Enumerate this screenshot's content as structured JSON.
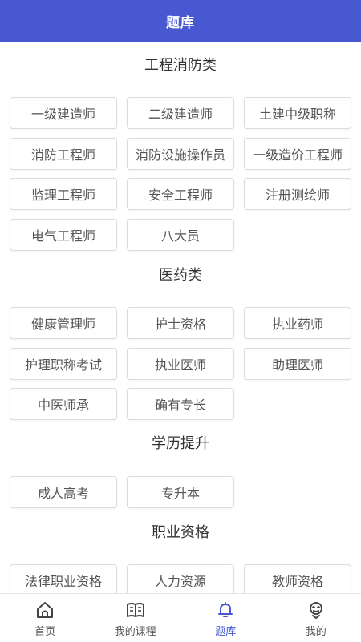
{
  "header": {
    "title": "题库"
  },
  "sections": [
    {
      "title": "工程消防类",
      "items": [
        "一级建造师",
        "二级建造师",
        "土建中级职称",
        "消防工程师",
        "消防设施操作员",
        "一级造价工程师",
        "监理工程师",
        "安全工程师",
        "注册测绘师",
        "电气工程师",
        "八大员"
      ]
    },
    {
      "title": "医药类",
      "items": [
        "健康管理师",
        "护士资格",
        "执业药师",
        "护理职称考试",
        "执业医师",
        "助理医师",
        "中医师承",
        "确有专长"
      ]
    },
    {
      "title": "学历提升",
      "items": [
        "成人高考",
        "专升本"
      ]
    },
    {
      "title": "职业资格",
      "items": [
        "法律职业资格",
        "人力资源",
        "教师资格"
      ]
    }
  ],
  "tabbar": {
    "items": [
      {
        "label": "首页",
        "icon": "home-icon",
        "active": false
      },
      {
        "label": "我的课程",
        "icon": "book-icon",
        "active": false
      },
      {
        "label": "题库",
        "icon": "bell-icon",
        "active": true
      },
      {
        "label": "我的",
        "icon": "profile-icon",
        "active": false
      }
    ],
    "active_color": "#4758d0",
    "inactive_color": "#555555"
  },
  "colors": {
    "header_bg": "#4758d0",
    "chip_border": "#dcdcdc"
  }
}
